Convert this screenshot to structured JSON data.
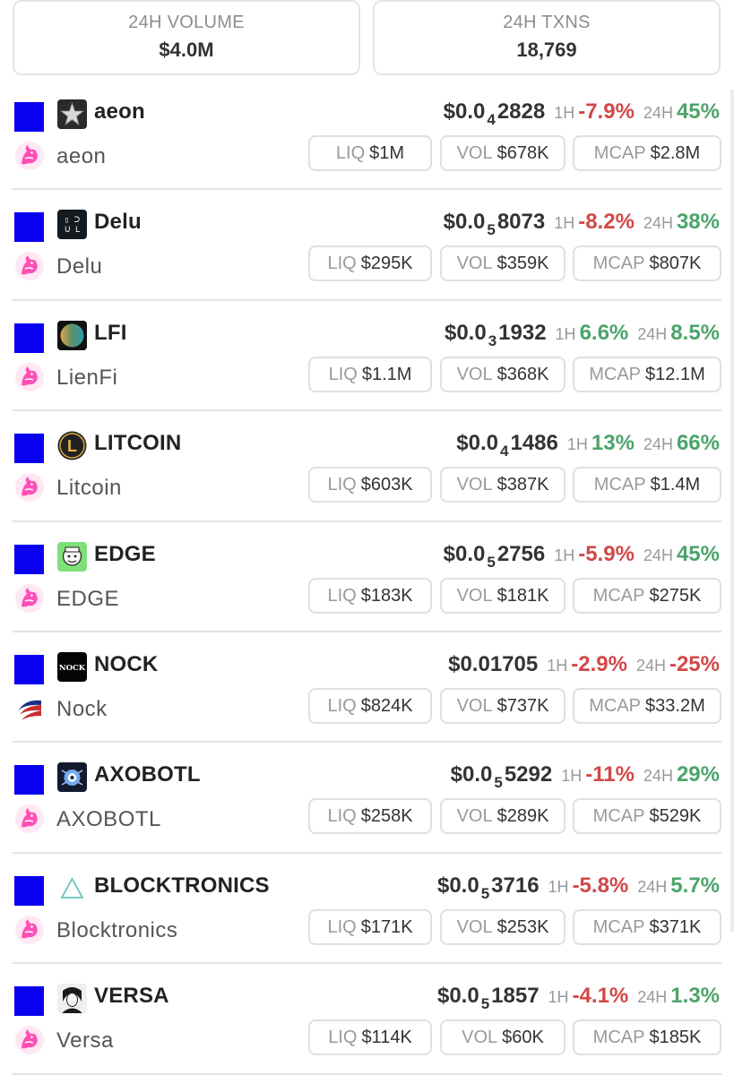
{
  "stats": {
    "volume_label": "24H VOLUME",
    "volume_value": "$4.0M",
    "txns_label": "24H TXNS",
    "txns_value": "18,769"
  },
  "labels": {
    "h1": "1H",
    "h24": "24H",
    "liq": "LIQ",
    "vol": "VOL",
    "mcap": "MCAP"
  },
  "colors": {
    "chain_square": "#0a00f0",
    "negative": "#d24747",
    "positive": "#4ca46a",
    "uniswap_pink": "#ff4fb5"
  },
  "tokens": [
    {
      "symbol": "aeon",
      "name": "aeon",
      "price_prefix": "$0.0",
      "price_sub": "4",
      "price_rest": "2828",
      "h1": "-7.9%",
      "h1_dir": "neg",
      "h24": "45%",
      "h24_dir": "pos",
      "liq": "$1M",
      "vol": "$678K",
      "mcap": "$2.8M",
      "logo": "star-logo",
      "dex_icon": "uniswap-icon"
    },
    {
      "symbol": "Delu",
      "name": "Delu",
      "price_prefix": "$0.0",
      "price_sub": "5",
      "price_rest": "8073",
      "h1": "-8.2%",
      "h1_dir": "neg",
      "h24": "38%",
      "h24_dir": "pos",
      "liq": "$295K",
      "vol": "$359K",
      "mcap": "$807K",
      "logo": "delu-logo",
      "dex_icon": "uniswap-icon"
    },
    {
      "symbol": "LFI",
      "name": "LienFi",
      "price_prefix": "$0.0",
      "price_sub": "3",
      "price_rest": "1932",
      "h1": "6.6%",
      "h1_dir": "pos",
      "h24": "8.5%",
      "h24_dir": "pos",
      "liq": "$1.1M",
      "vol": "$368K",
      "mcap": "$12.1M",
      "logo": "gradient-circle-logo",
      "dex_icon": "uniswap-icon"
    },
    {
      "symbol": "LITCOIN",
      "name": "Litcoin",
      "price_prefix": "$0.0",
      "price_sub": "4",
      "price_rest": "1486",
      "h1": "13%",
      "h1_dir": "pos",
      "h24": "66%",
      "h24_dir": "pos",
      "liq": "$603K",
      "vol": "$387K",
      "mcap": "$1.4M",
      "logo": "litecoin-logo",
      "dex_icon": "uniswap-icon"
    },
    {
      "symbol": "EDGE",
      "name": "EDGE",
      "price_prefix": "$0.0",
      "price_sub": "5",
      "price_rest": "2756",
      "h1": "-5.9%",
      "h1_dir": "neg",
      "h24": "45%",
      "h24_dir": "pos",
      "liq": "$183K",
      "vol": "$181K",
      "mcap": "$275K",
      "logo": "face-logo",
      "dex_icon": "uniswap-icon"
    },
    {
      "symbol": "NOCK",
      "name": "Nock",
      "price_prefix": "$0.01705",
      "price_sub": "",
      "price_rest": "",
      "h1": "-2.9%",
      "h1_dir": "neg",
      "h24": "-25%",
      "h24_dir": "neg",
      "liq": "$824K",
      "vol": "$737K",
      "mcap": "$33.2M",
      "logo": "nock-logo",
      "logo_text": "NOCK",
      "dex_icon": "swoosh-icon"
    },
    {
      "symbol": "AXOBOTL",
      "name": "AXOBOTL",
      "price_prefix": "$0.0",
      "price_sub": "5",
      "price_rest": "5292",
      "h1": "-11%",
      "h1_dir": "neg",
      "h24": "29%",
      "h24_dir": "pos",
      "liq": "$258K",
      "vol": "$289K",
      "mcap": "$529K",
      "logo": "axobotl-logo",
      "dex_icon": "uniswap-icon"
    },
    {
      "symbol": "BLOCKTRONICS",
      "name": "Blocktronics",
      "price_prefix": "$0.0",
      "price_sub": "5",
      "price_rest": "3716",
      "h1": "-5.8%",
      "h1_dir": "neg",
      "h24": "5.7%",
      "h24_dir": "pos",
      "liq": "$171K",
      "vol": "$253K",
      "mcap": "$371K",
      "logo": "triangle-logo",
      "dex_icon": "uniswap-icon"
    },
    {
      "symbol": "VERSA",
      "name": "Versa",
      "price_prefix": "$0.0",
      "price_sub": "5",
      "price_rest": "1857",
      "h1": "-4.1%",
      "h1_dir": "neg",
      "h24": "1.3%",
      "h24_dir": "pos",
      "liq": "$114K",
      "vol": "$60K",
      "mcap": "$185K",
      "logo": "portrait-logo",
      "dex_icon": "uniswap-icon"
    }
  ]
}
